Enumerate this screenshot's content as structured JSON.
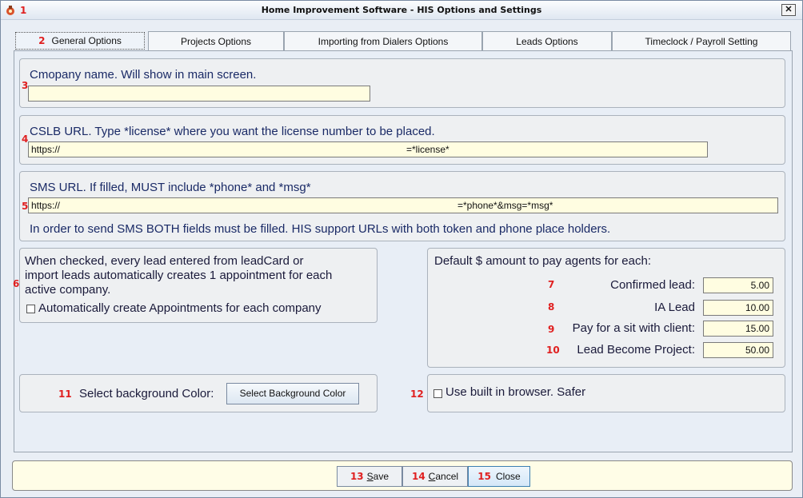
{
  "window": {
    "title": "Home Improvement Software - HIS Options and Settings"
  },
  "tabs": [
    {
      "label": "General Options",
      "num": "2"
    },
    {
      "label": "Projects Options"
    },
    {
      "label": "Importing from Dialers Options"
    },
    {
      "label": "Leads Options"
    },
    {
      "label": "Timeclock / Payroll Setting"
    }
  ],
  "company": {
    "label": "Cmopany name. Will show in main screen.",
    "value": "",
    "num": "3"
  },
  "cslb": {
    "label": "CSLB URL. Type *license* where you want the license number to be placed.",
    "value_left": "https://",
    "value_right": "=*license*",
    "num": "4"
  },
  "sms": {
    "label": "SMS URL. If filled, MUST include *phone* and *msg*",
    "value_left": "https://",
    "value_right": "=*phone*&msg=*msg*",
    "note": "In order to send SMS BOTH fields must be filled. HIS support URLs with both token and phone place holders.",
    "num": "5"
  },
  "appointments": {
    "description_1": "When checked, every lead entered from leadCard or",
    "description_2": "import leads automatically creates 1 appointment for each",
    "description_3": "active company.",
    "checkbox_label": "Automatically create Appointments for each company",
    "num": "6"
  },
  "pay": {
    "heading": "Default $ amount to pay agents for each:",
    "rows": [
      {
        "num": "7",
        "label": "Confirmed lead:",
        "value": "5.00"
      },
      {
        "num": "8",
        "label": "IA Lead",
        "value": "10.00"
      },
      {
        "num": "9",
        "label": "Pay for a sit with client:",
        "value": "15.00"
      },
      {
        "num": "10",
        "label": "Lead Become Project:",
        "value": "50.00"
      }
    ]
  },
  "background": {
    "num": "11",
    "label": "Select background Color:",
    "button_label": "Select Background Color"
  },
  "browser": {
    "num": "12",
    "label": "Use built in browser. Safer"
  },
  "footer": {
    "save": {
      "num": "13",
      "label_underlined": "S",
      "label_rest": "ave"
    },
    "cancel": {
      "num": "14",
      "label_underlined": "C",
      "label_rest": "ancel"
    },
    "close": {
      "num": "15",
      "label": "Close"
    }
  },
  "title_num": "1"
}
